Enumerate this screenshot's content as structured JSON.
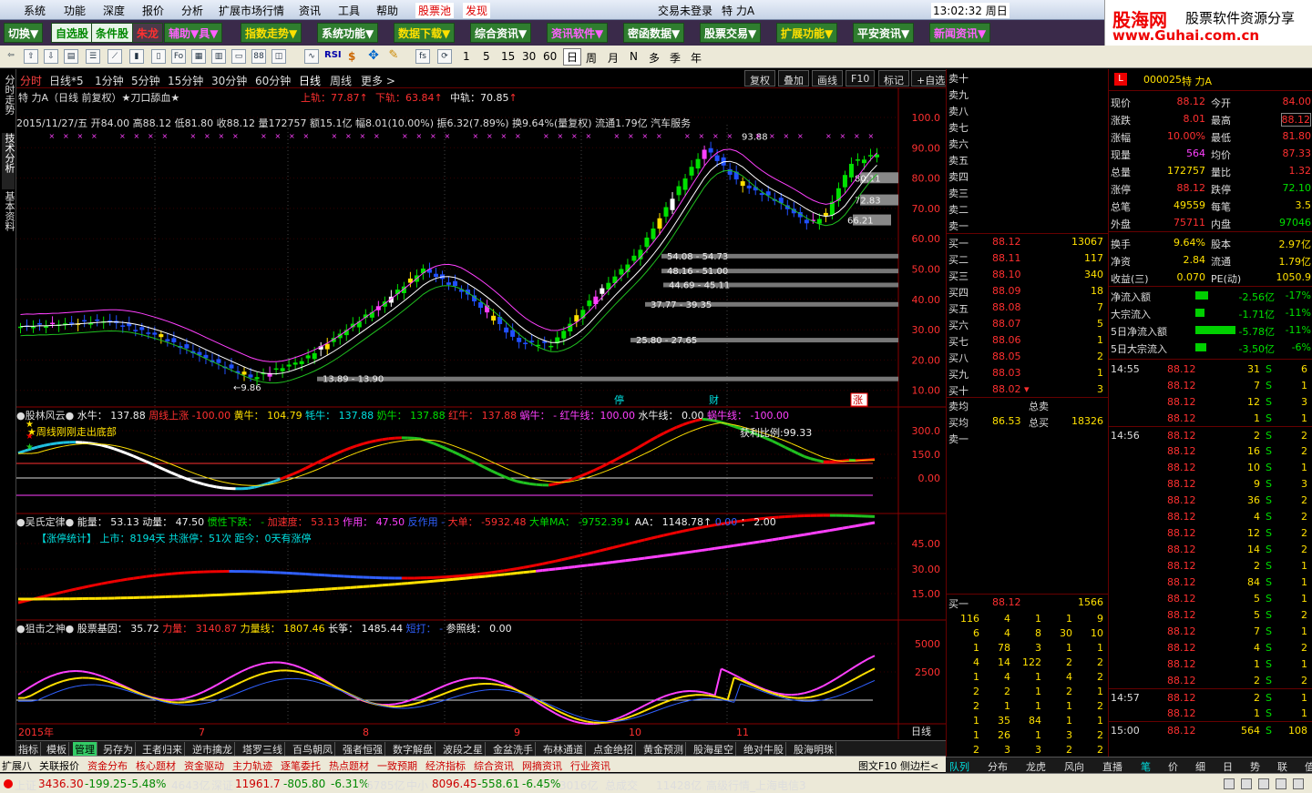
{
  "menu": {
    "items": [
      "系统",
      "功能",
      "深度",
      "报价",
      "分析",
      "扩展市场行情",
      "资讯",
      "工具",
      "帮助"
    ],
    "pool": "股票池",
    "discover": "发现",
    "status": "交易未登录",
    "stock": "特  力A",
    "time": "13:02:32 周日"
  },
  "logo": {
    "brand": "股海网",
    "slogan": "股票软件资源分享",
    "url": "www.Guhai.com.cn"
  },
  "nav": [
    "切换▼",
    "自选股",
    "条件股",
    "朱龙",
    "辅助▼具▼",
    "指数走势▼",
    "系统功能▼",
    "数据下载▼",
    "综合资讯▼",
    "资讯软件▼",
    "密函数据▼",
    "股票交易▼",
    "扩展功能▼",
    "平安资讯▼",
    "新闻资讯▼"
  ],
  "toolbar_nums": [
    "1",
    "5",
    "15",
    "30",
    "60",
    "日",
    "周",
    "月",
    "N",
    "多",
    "季",
    "年"
  ],
  "left_tabs": [
    "分时走势",
    "技术分析",
    "基本资料"
  ],
  "period": {
    "items": [
      "分时",
      "日线*5",
      "1分钟",
      "5分钟",
      "15分钟",
      "30分钟",
      "60分钟",
      "日线",
      "周线",
      "更多 >"
    ],
    "buttons": [
      "复权",
      "叠加",
      "画线",
      "F10",
      "标记",
      "+自选"
    ]
  },
  "main": {
    "title": "特  力A（日线 前复权）★刀口舔血★",
    "upper_label": "上轨：",
    "upper": "77.87",
    "lower_label": "下轨：",
    "lower": "63.84",
    "mid_label": "中轨：",
    "mid": "70.85",
    "ohlc": "2015/11/27/五 开84.00 高88.12 低81.80 收88.12 量172757 额15.1亿 幅8.01(10.00%) 振6.32(7.89%) 换9.64%(量复权) 流通1.79亿 汽车服务",
    "price_axis": [
      "100.0",
      "90.00",
      "80.00",
      "70.00",
      "60.00",
      "50.00",
      "40.00",
      "30.00",
      "20.00",
      "10.00"
    ],
    "zones": [
      "54.08 - 54.73",
      "48.16 - 51.00",
      "44.69 - 45.11",
      "37.77 - 39.35",
      "25.80 - 27.65",
      "13.89 - 13.90",
      "80.11",
      "72.83",
      "66.21"
    ],
    "high_label": "93.88",
    "low_label": "←9.86",
    "markers": [
      "停",
      "财",
      "涨"
    ]
  },
  "ind1": {
    "name": "股林风云",
    "items": [
      {
        "k": "水牛：",
        "v": "137.88",
        "c": "wht"
      },
      {
        "k": "周线上涨",
        "v": "-100.00",
        "c": "red"
      },
      {
        "k": "黄牛：",
        "v": "104.79",
        "c": "yel"
      },
      {
        "k": "牦牛：",
        "v": "137.88",
        "c": "cyn"
      },
      {
        "k": "奶牛：",
        "v": "137.88",
        "c": "grn"
      },
      {
        "k": "红牛：",
        "v": "137.88",
        "c": "red"
      },
      {
        "k": "蜗牛：",
        "v": "- 红牛线：100.00",
        "c": "mag"
      },
      {
        "k": "水牛线：",
        "v": "0.00",
        "c": "wht"
      },
      {
        "k": "蜗牛线：",
        "v": "-100.00",
        "c": "mag"
      }
    ],
    "note": "★周线刚刚走出底部",
    "ratio": "获利比例:99.33",
    "axis": [
      "300.0",
      "150.0",
      "0.00"
    ]
  },
  "ind2": {
    "name": "吴氏定律",
    "items": [
      {
        "k": "能量：",
        "v": "53.13",
        "c": "wht"
      },
      {
        "k": "动量：",
        "v": "47.50",
        "c": "wht"
      },
      {
        "k": "惯性下跌：",
        "v": "-",
        "c": "grn"
      },
      {
        "k": "加速度：",
        "v": "53.13",
        "c": "red"
      },
      {
        "k": "作用：",
        "v": "47.50",
        "c": "mag"
      },
      {
        "k": "反作用",
        "v": "-",
        "c": "blue"
      },
      {
        "k": "大单：",
        "v": "-5932.48",
        "c": "red"
      },
      {
        "k": "大单MA：",
        "v": "-9752.39↓",
        "c": "grn"
      },
      {
        "k": "AA：",
        "v": "1148.78↑",
        "c": "wht"
      },
      {
        "k": "",
        "v": "0.00",
        "c": "blue"
      },
      {
        "k": "：",
        "v": "2.00",
        "c": "wht"
      }
    ],
    "note": "【涨停统计】  上市：8194天  共涨停：51次  距今：0天有涨停",
    "axis": [
      "45.00",
      "30.00",
      "15.00"
    ]
  },
  "ind3": {
    "name": "狙击之神",
    "items": [
      {
        "k": "股票基因：",
        "v": "35.72",
        "c": "wht"
      },
      {
        "k": "力量：",
        "v": "3140.87",
        "c": "red"
      },
      {
        "k": "力量线：",
        "v": "1807.46",
        "c": "yel"
      },
      {
        "k": "长筝：",
        "v": "1485.44",
        "c": "wht"
      },
      {
        "k": "短打：",
        "v": "-",
        "c": "blue"
      },
      {
        "k": "参照线：",
        "v": "0.00",
        "c": "wht"
      }
    ],
    "axis": [
      "5000",
      "2500"
    ]
  },
  "date_axis": [
    "2015年",
    "7",
    "8",
    "9",
    "10",
    "11"
  ],
  "date_unit": "日线",
  "bottom_tabs": [
    "指标",
    "模板",
    "管理",
    "另存为",
    "王者归来",
    "逆市擒龙",
    "塔罗三线",
    "百鸟朝凤",
    "强者恒强",
    "数字解盘",
    "波段之星",
    "金盆洗手",
    "布林通道",
    "点金绝招",
    "黄金预测",
    "股海星空",
    "绝对牛股",
    "股海明珠"
  ],
  "toolbar2": [
    "扩展八",
    "关联报价",
    "资金分布",
    "核心题材",
    "资金驱动",
    "主力轨迹",
    "逐笔委托",
    "热点题材",
    "一致预期",
    "经济指标",
    "综合资讯",
    "网摘资讯",
    "行业资讯",
    "图文F10",
    "侧边栏<"
  ],
  "status": {
    "sh_label": "上证",
    "sh": "3436.30",
    "sh_chg": "-199.25",
    "sh_pct": "-5.48%",
    "sh_amt": "4643亿",
    "sz_label": "深证",
    "sz": "11961.7",
    "sz_chg": "-805.80",
    "sz_pct": "-6.31%",
    "sz_amt": "6785亿",
    "zx_label": "中小",
    "zx": "8096.45",
    "zx_chg": "-558.61",
    "zx_pct": "-6.45%",
    "zx_amt": "3016亿",
    "total_label": "总成交",
    "total": "11428亿",
    "server": "高级行情_上海电信3"
  },
  "orderbook": {
    "sells": [
      [
        "卖十",
        "",
        ""
      ],
      [
        "卖九",
        "",
        ""
      ],
      [
        "卖八",
        "",
        ""
      ],
      [
        "卖七",
        "",
        ""
      ],
      [
        "卖六",
        "",
        ""
      ],
      [
        "卖五",
        "",
        ""
      ],
      [
        "卖四",
        "",
        ""
      ],
      [
        "卖三",
        "",
        ""
      ],
      [
        "卖二",
        "",
        ""
      ],
      [
        "卖一",
        "",
        ""
      ]
    ],
    "buys": [
      [
        "买一",
        "88.12",
        "13067"
      ],
      [
        "买二",
        "88.11",
        "117"
      ],
      [
        "买三",
        "88.10",
        "340"
      ],
      [
        "买四",
        "88.09",
        "18"
      ],
      [
        "买五",
        "88.08",
        "7"
      ],
      [
        "买六",
        "88.07",
        "5"
      ],
      [
        "买七",
        "88.06",
        "1"
      ],
      [
        "买八",
        "88.05",
        "2"
      ],
      [
        "买九",
        "88.03",
        "1"
      ],
      [
        "买十",
        "88.02 ▾",
        "3"
      ]
    ],
    "avg_sell": "卖均",
    "total_sell": "总卖",
    "avg_buy": "买均",
    "avg_buy_v": "86.53",
    "total_buy": "总买",
    "total_buy_v": "18326",
    "sell1": "卖一",
    "buy1": "买一",
    "buy1_p": "88.12",
    "buy1_v": "1566",
    "queue": [
      [
        "116",
        "4",
        "1",
        "1",
        "9"
      ],
      [
        "6",
        "4",
        "8",
        "30",
        "10"
      ],
      [
        "1",
        "78",
        "3",
        "1",
        "1"
      ],
      [
        "4",
        "14",
        "122",
        "2",
        "2"
      ],
      [
        "1",
        "4",
        "1",
        "4",
        "2"
      ],
      [
        "2",
        "2",
        "1",
        "2",
        "1"
      ],
      [
        "2",
        "1",
        "1",
        "1",
        "2"
      ],
      [
        "1",
        "35",
        "84",
        "1",
        "1"
      ],
      [
        "1",
        "26",
        "1",
        "3",
        "2"
      ],
      [
        "2",
        "3",
        "3",
        "2",
        "2"
      ]
    ]
  },
  "quote": {
    "code": "000025",
    "name": "特  力A",
    "rows": [
      [
        "现价",
        "88.12",
        "今开",
        "84.00"
      ],
      [
        "涨跌",
        "8.01",
        "最高",
        "88.12"
      ],
      [
        "涨幅",
        "10.00%",
        "最低",
        "81.80"
      ],
      [
        "现量",
        "564",
        "均价",
        "87.33"
      ],
      [
        "总量",
        "172757",
        "量比",
        "1.32"
      ],
      [
        "涨停",
        "88.12",
        "跌停",
        "72.10"
      ],
      [
        "总笔",
        "49559",
        "每笔",
        "3.5"
      ],
      [
        "外盘",
        "75711",
        "内盘",
        "97046"
      ],
      [
        "换手",
        "9.64%",
        "股本",
        "2.97亿"
      ],
      [
        "净资",
        "2.84",
        "流通",
        "1.79亿"
      ],
      [
        "收益(三)",
        "0.070",
        "PE(动)",
        "1050.9"
      ]
    ],
    "flows": [
      [
        "净流入额",
        "-2.56亿",
        "-17%",
        14
      ],
      [
        "大宗流入",
        "-1.71亿",
        "-11%",
        10
      ],
      [
        "5日净流入额",
        "-5.78亿",
        "-11%",
        44
      ],
      [
        "5日大宗流入",
        "-3.50亿",
        "-6%",
        12
      ]
    ],
    "ticks": [
      [
        "14:55",
        "88.12",
        "31",
        "S",
        "6"
      ],
      [
        "",
        "88.12",
        "7",
        "S",
        "1"
      ],
      [
        "",
        "88.12",
        "12",
        "S",
        "3"
      ],
      [
        "",
        "88.12",
        "1",
        "S",
        "1"
      ],
      [
        "14:56",
        "88.12",
        "2",
        "S",
        "2"
      ],
      [
        "",
        "88.12",
        "16",
        "S",
        "2"
      ],
      [
        "",
        "88.12",
        "10",
        "S",
        "1"
      ],
      [
        "",
        "88.12",
        "9",
        "S",
        "3"
      ],
      [
        "",
        "88.12",
        "36",
        "S",
        "2"
      ],
      [
        "",
        "88.12",
        "4",
        "S",
        "2"
      ],
      [
        "",
        "88.12",
        "12",
        "S",
        "2"
      ],
      [
        "",
        "88.12",
        "14",
        "S",
        "2"
      ],
      [
        "",
        "88.12",
        "2",
        "S",
        "1"
      ],
      [
        "",
        "88.12",
        "84",
        "S",
        "1"
      ],
      [
        "",
        "88.12",
        "5",
        "S",
        "1"
      ],
      [
        "",
        "88.12",
        "5",
        "S",
        "2"
      ],
      [
        "",
        "88.12",
        "7",
        "S",
        "1"
      ],
      [
        "",
        "88.12",
        "4",
        "S",
        "2"
      ],
      [
        "",
        "88.12",
        "1",
        "S",
        "1"
      ],
      [
        "",
        "88.12",
        "2",
        "S",
        "2"
      ],
      [
        "14:57",
        "88.12",
        "2",
        "S",
        "1"
      ],
      [
        "",
        "88.12",
        "1",
        "S",
        "1"
      ],
      [
        "15:00",
        "88.12",
        "564",
        "S",
        "108"
      ]
    ]
  },
  "side_tabs": [
    "队列",
    "分布",
    "龙虎",
    "风向",
    "直播",
    "笔",
    "价",
    "细",
    "日",
    "势",
    "联",
    "值",
    "筹"
  ]
}
